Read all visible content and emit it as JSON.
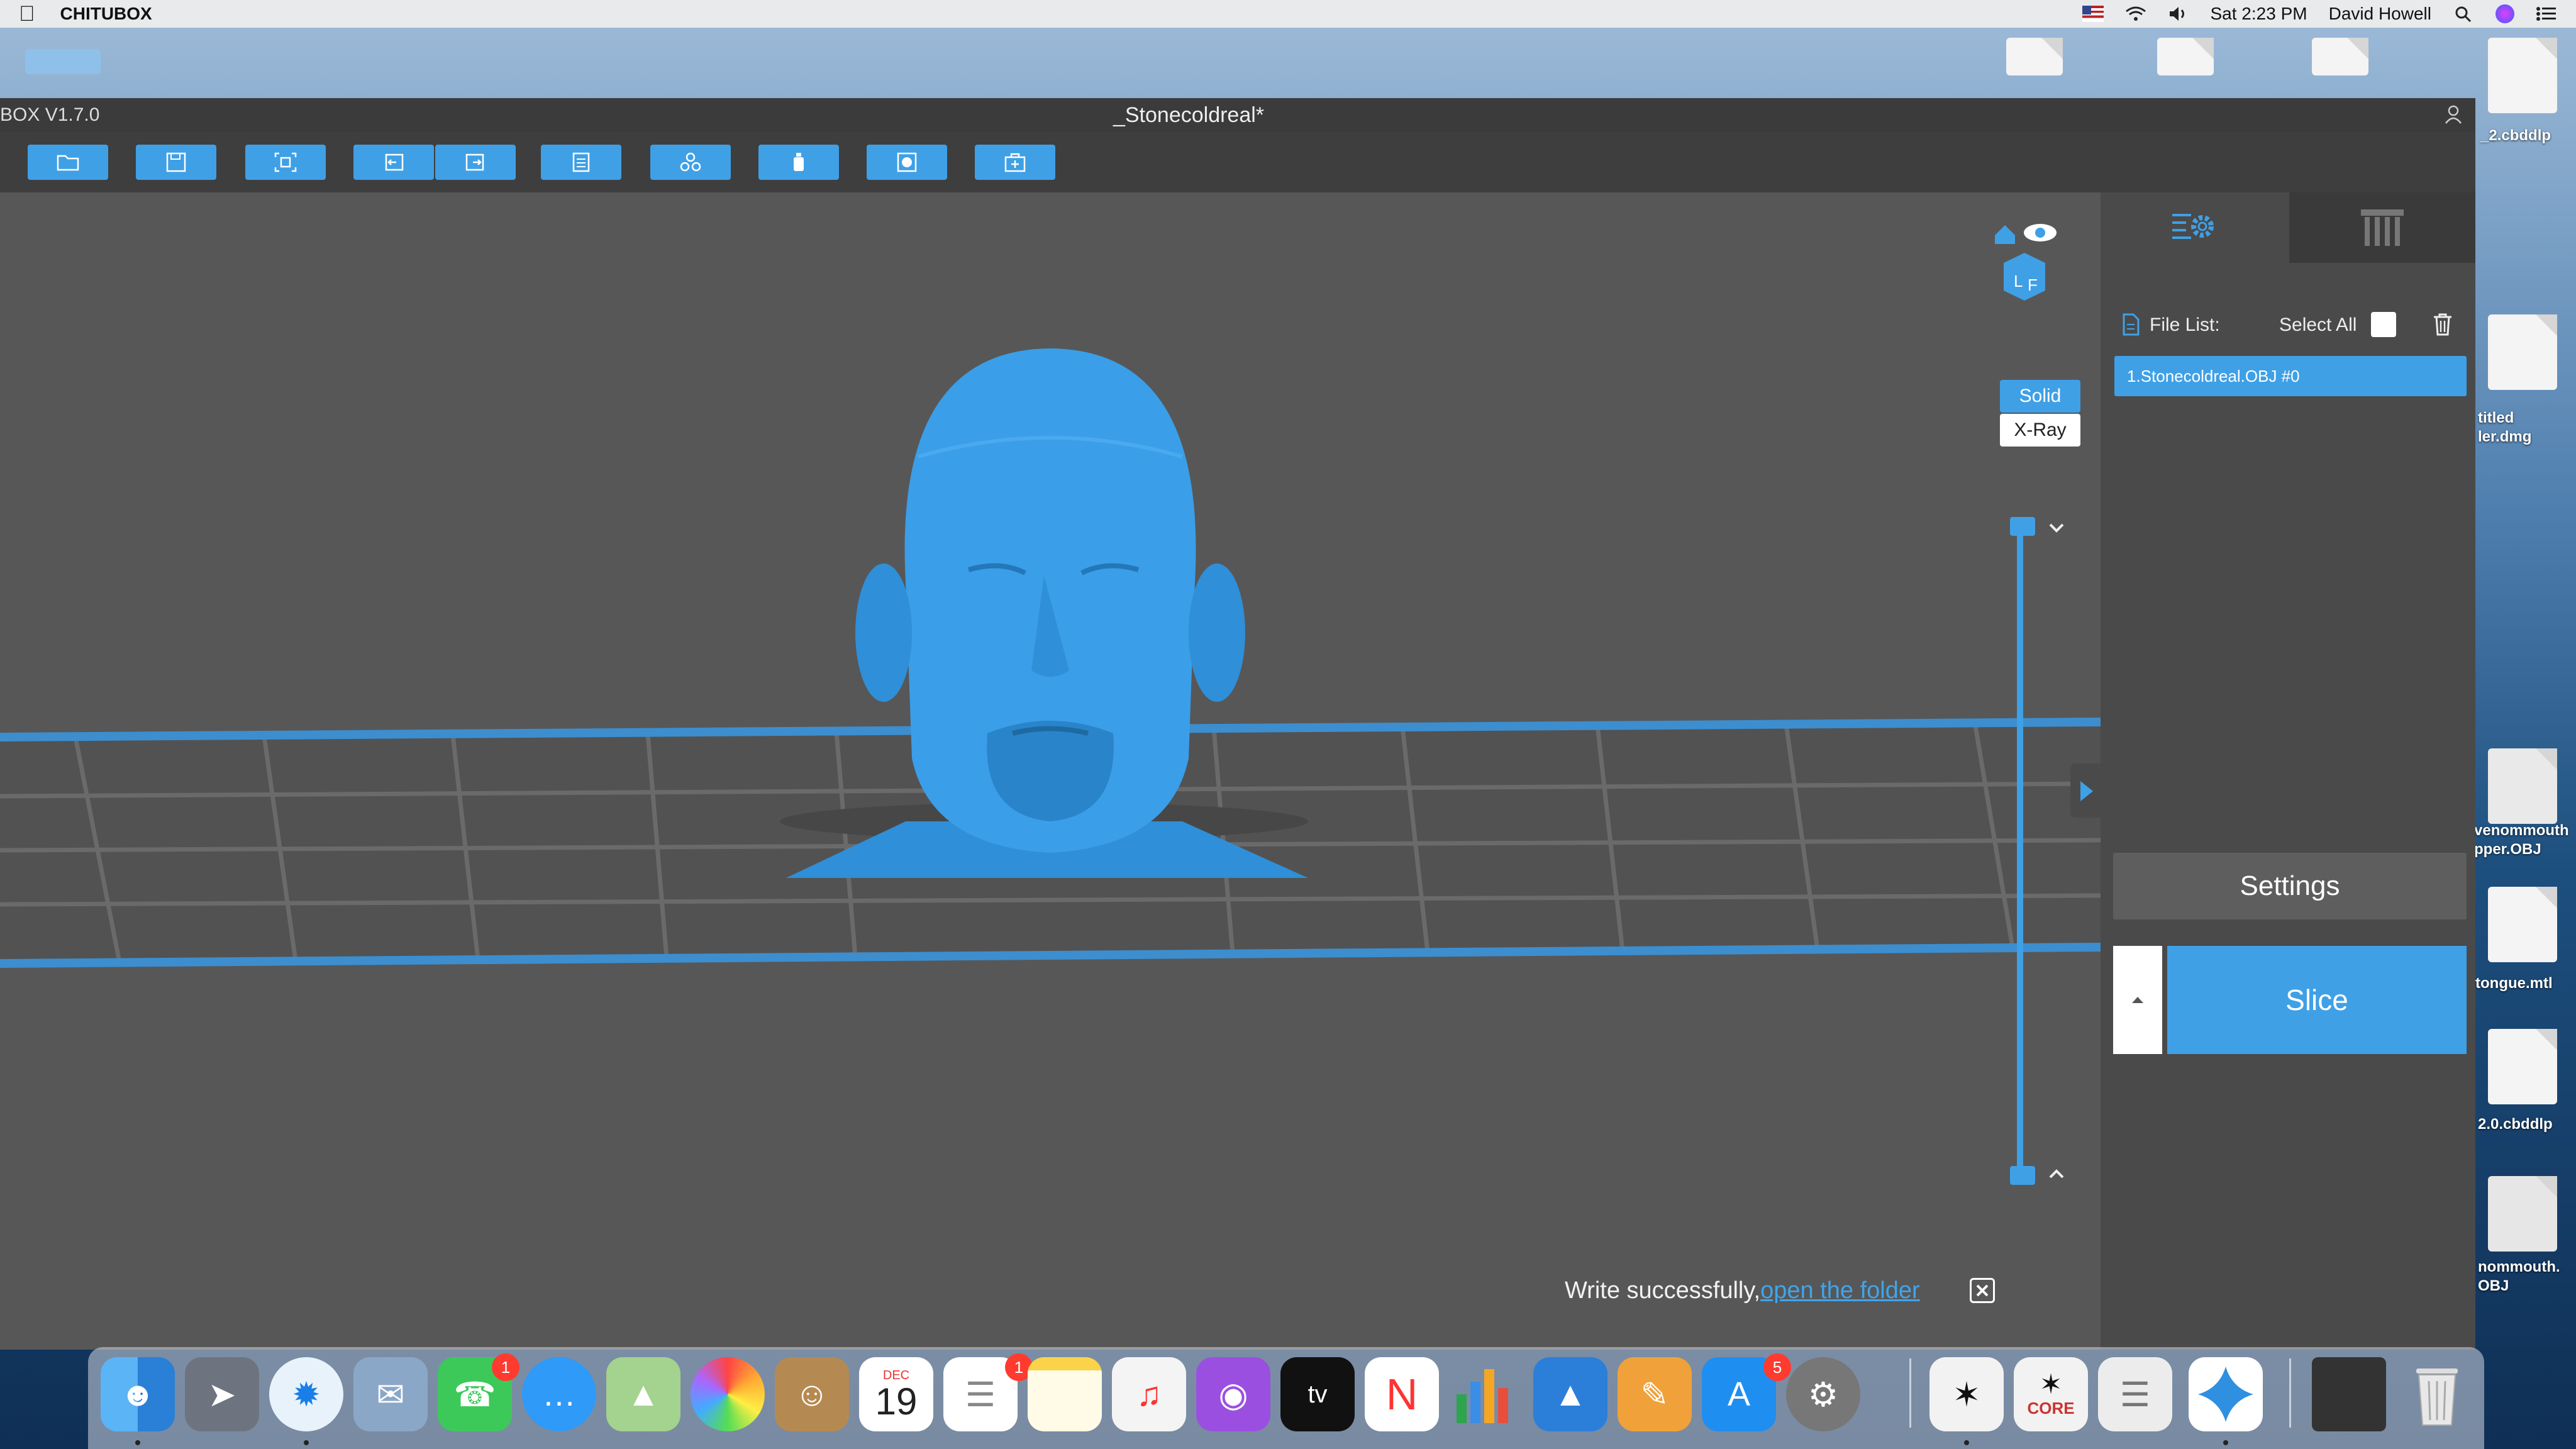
{
  "menubar": {
    "app_name": "CHITUBOX",
    "clock": "Sat 2:23 PM",
    "user": "David Howell"
  },
  "desktop": {
    "files": [
      {
        "label": "_2.cbddlp"
      },
      {
        "label": "titled\nler.dmg"
      },
      {
        "label": "venommouth\npper.OBJ"
      },
      {
        "label": "tongue.mtl"
      },
      {
        "label": "2.0.cbddlp"
      },
      {
        "label": "nommouth.\nOBJ"
      }
    ]
  },
  "window": {
    "version": "BOX V1.7.0",
    "title": "_Stonecoldreal*"
  },
  "viewport": {
    "view_modes": {
      "solid": "Solid",
      "xray": "X-Ray"
    },
    "notification": {
      "text": "Write successfully,",
      "link": "open the folder"
    }
  },
  "panel": {
    "file_list_label": "File List:",
    "select_all_label": "Select All",
    "files": [
      "1.Stonecoldreal.OBJ #0"
    ],
    "settings_label": "Settings",
    "slice_label": "Slice"
  },
  "dock": {
    "calendar_month": "DEC",
    "calendar_day": "19",
    "facetime_badge": "1",
    "reminders_badge": "1",
    "appstore_badge": "5",
    "appletv_label": "tv",
    "zbrush_core_label": "CORE"
  },
  "colors": {
    "accent": "#3fa0e6",
    "viewport_bg": "#575757",
    "panel_bg": "#4a4a4a"
  }
}
